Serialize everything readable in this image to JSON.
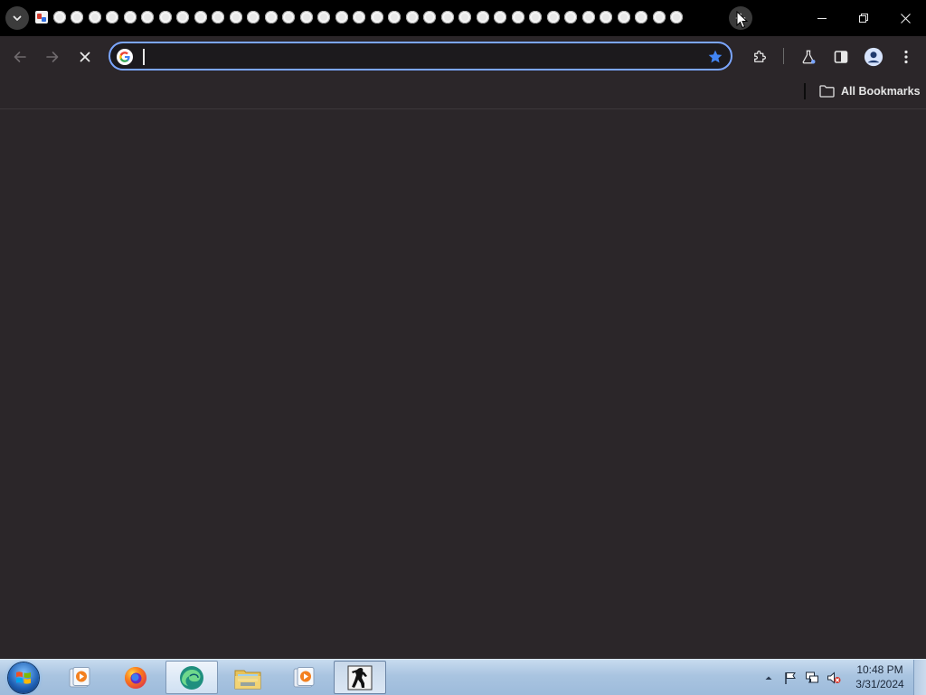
{
  "browser": {
    "tab_count": 37,
    "omnibox": {
      "value": "",
      "placeholder": ""
    },
    "bookmarks_bar": {
      "all_bookmarks_label": "All Bookmarks"
    },
    "accent_color": "#7ba6ff",
    "star_color": "#4285f4"
  },
  "icons": {
    "tab_search": "chevron-down-icon",
    "new_tab": "plus-icon",
    "back": "arrow-left-icon",
    "forward": "arrow-right-icon",
    "stop": "close-icon",
    "omnibox_engine": "google-icon",
    "bookmark_star": "star-icon",
    "extensions": "puzzle-icon",
    "labs": "flask-icon",
    "side_panel": "side-panel-icon",
    "profile": "avatar-icon",
    "menu": "kebab-menu-icon",
    "bookmarks_folder": "folder-icon"
  },
  "taskbar": {
    "apps": [
      {
        "name": "media-player-icon"
      },
      {
        "name": "firefox-icon"
      },
      {
        "name": "edge-icon"
      },
      {
        "name": "file-explorer-icon"
      },
      {
        "name": "media-player-icon"
      },
      {
        "name": "counter-strike-icon"
      }
    ],
    "clock": {
      "time": "10:48 PM",
      "date": "3/31/2024"
    }
  }
}
